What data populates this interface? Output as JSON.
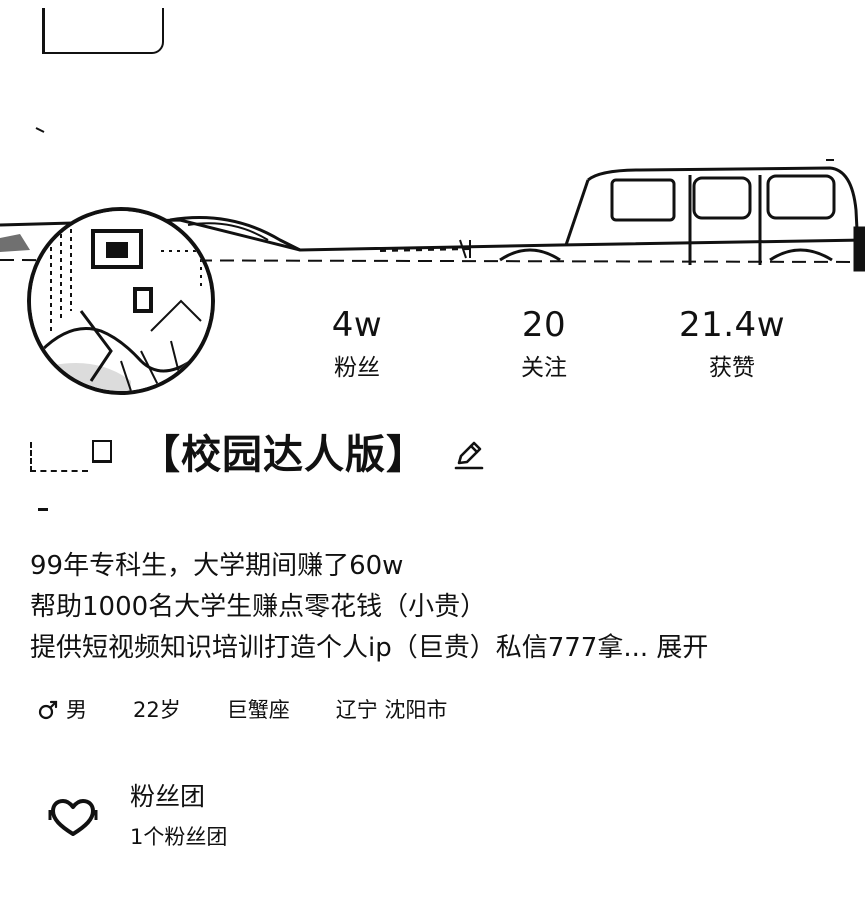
{
  "profile": {
    "display_name": "【校园达人版】",
    "avatar_icon": "avatar-photo",
    "edit_icon": "pencil-icon"
  },
  "stats": [
    {
      "value": "4w",
      "label": "粉丝"
    },
    {
      "value": "20",
      "label": "关注"
    },
    {
      "value": "21.4w",
      "label": "获赞"
    }
  ],
  "bio": {
    "line1": "99年专科生，大学期间赚了60w",
    "line2": "帮助1000名大学生赚点零花钱（小贵）",
    "line3": "提供短视频知识培训打造个人ip（巨贵）私信777拿...",
    "expand_label": "展开"
  },
  "tags": {
    "gender": "男",
    "gender_icon": "male-icon",
    "age": "22岁",
    "zodiac": "巨蟹座",
    "location": "辽宁 沈阳市"
  },
  "fan_group": {
    "icon": "heart-icon",
    "title": "粉丝团",
    "subtitle": "1个粉丝团"
  }
}
